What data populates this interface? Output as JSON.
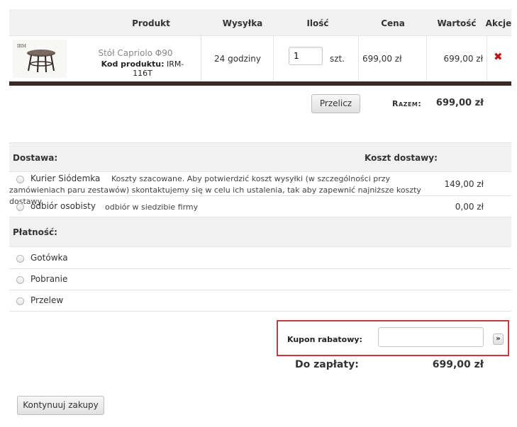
{
  "cart": {
    "headers": {
      "product": "Produkt",
      "shipping": "Wysyłka",
      "quantity": "Ilość",
      "price": "Cena",
      "value": "Wartość",
      "actions": "Akcje"
    },
    "items": [
      {
        "thumb_brand": "IRM",
        "name": "Stół Capriolo Φ90",
        "code_label": "Kod produktu:",
        "code": "IRM-116T",
        "shipping_time": "24 godziny",
        "quantity": "1",
        "unit": "szt.",
        "price": "699,00 zł",
        "value": "699,00 zł",
        "delete_icon": "✖"
      }
    ],
    "recalc_label": "Przelicz",
    "subtotal_label": "Razem:",
    "subtotal_value": "699,00 zł"
  },
  "shipping": {
    "header": "Dostawa:",
    "cost_header": "Koszt dostawy:",
    "options": [
      {
        "label": "Kurier Siódemka",
        "description": "Koszty szacowane. Aby potwierdzić koszt wysyłki (w szczególności przy zamówieniach paru zestawów) skontaktujemy się w celu ich ustalenia, tak aby zapewnić najniższe koszty dostawy.",
        "cost": "149,00 zł"
      },
      {
        "label": "odbiór osobisty",
        "description": "odbiór w siedzibie firmy",
        "cost": "0,00 zł"
      }
    ]
  },
  "payment": {
    "header": "Płatność:",
    "options": [
      "Gotówka",
      "Pobranie",
      "Przelew"
    ]
  },
  "coupon": {
    "label": "Kupon rabatowy:",
    "value": "",
    "placeholder": "",
    "button_label": "»"
  },
  "total": {
    "label": "Do zapłaty:",
    "value": "699,00 zł"
  },
  "continue_label": "Kontynuuj zakupy",
  "colors": {
    "accent_bar": "#3a2a24",
    "delete": "#c0141b",
    "coupon_highlight": "#c43a3f"
  }
}
